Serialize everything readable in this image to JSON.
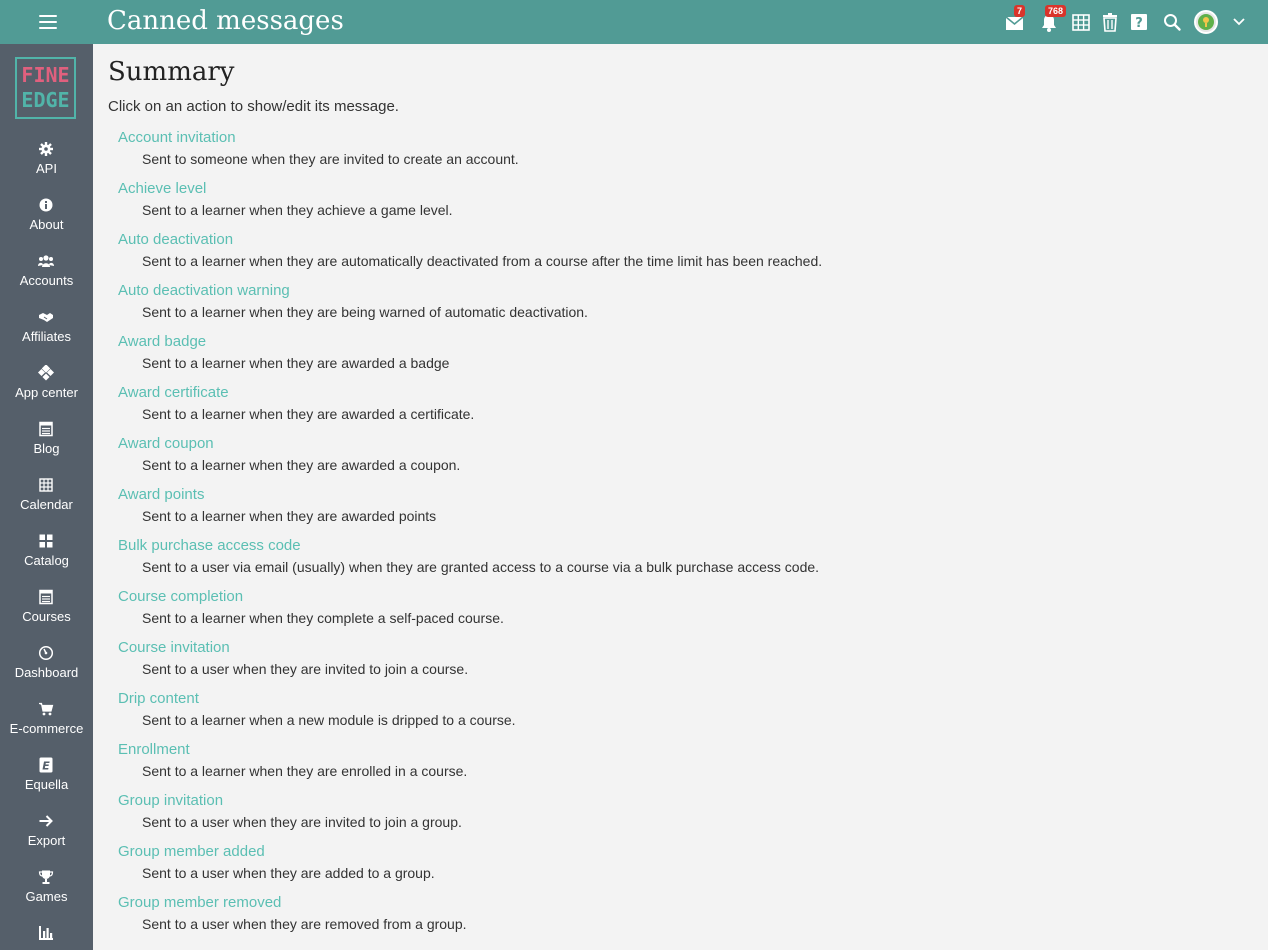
{
  "header": {
    "title": "Canned messages",
    "messages_badge": "7",
    "notifications_badge": "768"
  },
  "logo": {
    "line1": "FINE",
    "line2": "EDGE"
  },
  "sidebar": {
    "items": [
      {
        "label": "API",
        "icon": "gear-icon"
      },
      {
        "label": "About",
        "icon": "info-icon"
      },
      {
        "label": "Accounts",
        "icon": "users-icon"
      },
      {
        "label": "Affiliates",
        "icon": "handshake-icon"
      },
      {
        "label": "App center",
        "icon": "apps-icon"
      },
      {
        "label": "Blog",
        "icon": "blog-icon"
      },
      {
        "label": "Calendar",
        "icon": "calendar-icon"
      },
      {
        "label": "Catalog",
        "icon": "grid-icon"
      },
      {
        "label": "Courses",
        "icon": "courses-icon"
      },
      {
        "label": "Dashboard",
        "icon": "gauge-icon"
      },
      {
        "label": "E-commerce",
        "icon": "cart-icon"
      },
      {
        "label": "Equella",
        "icon": "equella-icon"
      },
      {
        "label": "Export",
        "icon": "arrow-right-icon"
      },
      {
        "label": "Games",
        "icon": "trophy-icon"
      },
      {
        "label": "",
        "icon": "bar-chart-icon"
      }
    ]
  },
  "main": {
    "title": "Summary",
    "instructions": "Click on an action to show/edit its message.",
    "messages": [
      {
        "name": "Account invitation",
        "description": "Sent to someone when they are invited to create an account."
      },
      {
        "name": "Achieve level",
        "description": "Sent to a learner when they achieve a game level."
      },
      {
        "name": "Auto deactivation",
        "description": "Sent to a learner when they are automatically deactivated from a course after the time limit has been reached."
      },
      {
        "name": "Auto deactivation warning",
        "description": "Sent to a learner when they are being warned of automatic deactivation."
      },
      {
        "name": "Award badge",
        "description": "Sent to a learner when they are awarded a badge"
      },
      {
        "name": "Award certificate",
        "description": "Sent to a learner when they are awarded a certificate."
      },
      {
        "name": "Award coupon",
        "description": "Sent to a learner when they are awarded a coupon."
      },
      {
        "name": "Award points",
        "description": "Sent to a learner when they are awarded points"
      },
      {
        "name": "Bulk purchase access code",
        "description": "Sent to a user via email (usually) when they are granted access to a course via a bulk purchase access code."
      },
      {
        "name": "Course completion",
        "description": "Sent to a learner when they complete a self-paced course."
      },
      {
        "name": "Course invitation",
        "description": "Sent to a user when they are invited to join a course."
      },
      {
        "name": "Drip content",
        "description": "Sent to a learner when a new module is dripped to a course."
      },
      {
        "name": "Enrollment",
        "description": "Sent to a learner when they are enrolled in a course."
      },
      {
        "name": "Group invitation",
        "description": "Sent to a user when they are invited to join a group."
      },
      {
        "name": "Group member added",
        "description": "Sent to a user when they are added to a group."
      },
      {
        "name": "Group member removed",
        "description": "Sent to a user when they are removed from a group."
      }
    ]
  },
  "colors": {
    "topbar": "#519b95",
    "sidebar": "#555f6a",
    "link": "#5bbfb3",
    "badge": "#d9342b"
  }
}
